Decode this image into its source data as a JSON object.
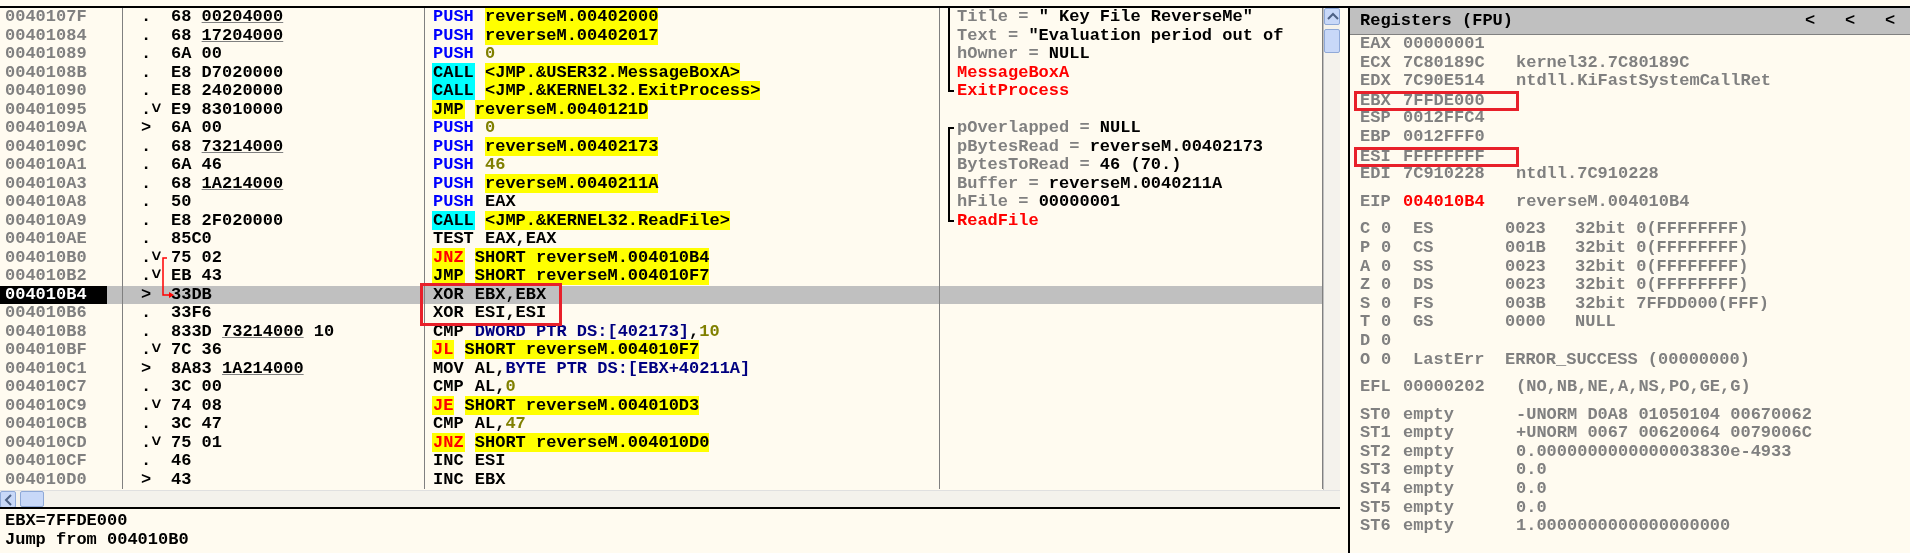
{
  "disassembly": {
    "rows": [
      {
        "address": "0040107F",
        "marker": ".",
        "opcode": "68",
        "hex_ref": "00204000",
        "mnemonic": "PUSH",
        "kind": "stack",
        "operand": [
          {
            "text": "reverseM.00402000",
            "kind": "ref"
          }
        ],
        "comment": {
          "kind": "arg",
          "name": "Title",
          "separator": "=",
          "value": "\" Key File ReverseMe\"",
          "nested": true
        },
        "selected": false,
        "annotated": false,
        "jump_source": false,
        "jump_target": false
      },
      {
        "address": "00401084",
        "marker": ".",
        "opcode": "68",
        "hex_ref": "17204000",
        "mnemonic": "PUSH",
        "kind": "stack",
        "operand": [
          {
            "text": "reverseM.00402017",
            "kind": "ref"
          }
        ],
        "comment": {
          "kind": "arg",
          "name": "Text",
          "separator": "=",
          "value": "\"Evaluation period out of",
          "nested": true
        },
        "selected": false,
        "annotated": false,
        "jump_source": false,
        "jump_target": false
      },
      {
        "address": "00401089",
        "marker": ".",
        "opcode": "6A 00",
        "mnemonic": "PUSH",
        "kind": "stack",
        "operand": [
          {
            "text": "0",
            "kind": "num"
          }
        ],
        "comment": {
          "kind": "arg",
          "name": "hOwner",
          "separator": "=",
          "value": "NULL",
          "nested": true
        },
        "selected": false,
        "annotated": false,
        "jump_source": false,
        "jump_target": false
      },
      {
        "address": "0040108B",
        "marker": ".",
        "opcode": "E8 D7020000",
        "mnemonic": "CALL",
        "kind": "invoke",
        "operand": [
          {
            "text": "<JMP.&USER32.MessageBoxA>",
            "kind": "ref"
          }
        ],
        "comment": {
          "kind": "call",
          "name": "MessageBoxA",
          "nested": true
        },
        "selected": false,
        "annotated": false,
        "jump_source": false,
        "jump_target": false
      },
      {
        "address": "00401090",
        "marker": ".",
        "opcode": "E8 24020000",
        "mnemonic": "CALL",
        "kind": "invoke",
        "operand": [
          {
            "text": "<JMP.&KERNEL32.ExitProcess>",
            "kind": "ref"
          }
        ],
        "comment": {
          "kind": "call",
          "name": "ExitProcess",
          "nested": false
        },
        "selected": false,
        "annotated": false,
        "jump_source": false,
        "jump_target": false
      },
      {
        "address": "00401095",
        "marker": ".˅",
        "opcode": "E9 83010000",
        "mnemonic": "JMP",
        "kind": "jump",
        "operand": [
          {
            "text": "reverseM.0040121D",
            "kind": "ref"
          }
        ],
        "selected": false,
        "annotated": false,
        "jump_source": false,
        "jump_target": false
      },
      {
        "address": "0040109A",
        "marker": ">",
        "opcode": "6A 00",
        "mnemonic": "PUSH",
        "kind": "stack",
        "operand": [
          {
            "text": "0",
            "kind": "num"
          }
        ],
        "comment": {
          "kind": "arg",
          "name": "pOverlapped",
          "separator": "=",
          "value": "NULL",
          "nested": false
        },
        "selected": false,
        "annotated": false,
        "jump_source": false,
        "jump_target": false
      },
      {
        "address": "0040109C",
        "marker": ".",
        "opcode": "68",
        "hex_ref": "73214000",
        "mnemonic": "PUSH",
        "kind": "stack",
        "operand": [
          {
            "text": "reverseM.00402173",
            "kind": "ref"
          }
        ],
        "comment": {
          "kind": "arg",
          "name": "pBytesRead",
          "separator": "=",
          "value": "reverseM.00402173",
          "nested": false
        },
        "selected": false,
        "annotated": false,
        "jump_source": false,
        "jump_target": false
      },
      {
        "address": "004010A1",
        "marker": ".",
        "opcode": "6A 46",
        "mnemonic": "PUSH",
        "kind": "stack",
        "operand": [
          {
            "text": "46",
            "kind": "num"
          }
        ],
        "comment": {
          "kind": "arg",
          "name": "BytesToRead",
          "separator": "=",
          "value": "46 (70.)",
          "nested": false
        },
        "selected": false,
        "annotated": false,
        "jump_source": false,
        "jump_target": false
      },
      {
        "address": "004010A3",
        "marker": ".",
        "opcode": "68",
        "hex_ref": "1A214000",
        "mnemonic": "PUSH",
        "kind": "stack",
        "operand": [
          {
            "text": "reverseM.0040211A",
            "kind": "ref"
          }
        ],
        "comment": {
          "kind": "arg",
          "name": "Buffer",
          "separator": "=",
          "value": "reverseM.0040211A",
          "nested": false
        },
        "selected": false,
        "annotated": false,
        "jump_source": false,
        "jump_target": false
      },
      {
        "address": "004010A8",
        "marker": ".",
        "opcode": "50",
        "mnemonic": "PUSH",
        "kind": "stack",
        "operand": [
          {
            "text": "EAX",
            "kind": "plain"
          }
        ],
        "comment": {
          "kind": "arg",
          "name": "hFile",
          "separator": "=",
          "value": "00000001",
          "nested": false
        },
        "selected": false,
        "annotated": false,
        "jump_source": false,
        "jump_target": false
      },
      {
        "address": "004010A9",
        "marker": ".",
        "opcode": "E8 2F020000",
        "mnemonic": "CALL",
        "kind": "invoke",
        "operand": [
          {
            "text": "<JMP.&KERNEL32.ReadFile>",
            "kind": "ref"
          }
        ],
        "comment": {
          "kind": "call",
          "name": "ReadFile",
          "nested": false
        },
        "selected": false,
        "annotated": false,
        "jump_source": false,
        "jump_target": false
      },
      {
        "address": "004010AE",
        "marker": ".",
        "opcode": "85C0",
        "mnemonic": "TEST",
        "kind": "plain",
        "operand": [
          {
            "text": "EAX,EAX",
            "kind": "plain"
          }
        ],
        "selected": false,
        "annotated": false,
        "jump_source": false,
        "jump_target": false
      },
      {
        "address": "004010B0",
        "marker": ".˅",
        "opcode": "75 02",
        "mnemonic": "JNZ",
        "kind": "branch",
        "operand": [
          {
            "text": "SHORT reverseM.004010B4",
            "kind": "ref"
          }
        ],
        "selected": false,
        "annotated": false,
        "jump_source": true,
        "jump_target": false
      },
      {
        "address": "004010B2",
        "marker": ".˅",
        "opcode": "EB 43",
        "mnemonic": "JMP",
        "kind": "jump",
        "operand": [
          {
            "text": "SHORT reverseM.004010F7",
            "kind": "ref"
          }
        ],
        "selected": false,
        "annotated": false,
        "jump_source": false,
        "jump_target": false
      },
      {
        "address": "004010B4",
        "marker": ">",
        "opcode": "33DB",
        "mnemonic": "XOR",
        "kind": "plain",
        "operand": [
          {
            "text": "EBX,EBX",
            "kind": "plain"
          }
        ],
        "selected": true,
        "annotated": true,
        "jump_source": false,
        "jump_target": true
      },
      {
        "address": "004010B6",
        "marker": ".",
        "opcode": "33F6",
        "mnemonic": "XOR",
        "kind": "plain",
        "operand": [
          {
            "text": "ESI,ESI",
            "kind": "plain"
          }
        ],
        "selected": false,
        "annotated": true,
        "jump_source": false,
        "jump_target": false
      },
      {
        "address": "004010B8",
        "marker": ".",
        "opcode": "833D",
        "hex_ref": "73214000",
        "hex_tail": "10",
        "mnemonic": "CMP",
        "kind": "plain",
        "operand": [
          {
            "text": "DWORD PTR DS:[402173]",
            "kind": "mem"
          },
          {
            "text": ",",
            "kind": "plain"
          },
          {
            "text": "10",
            "kind": "num"
          }
        ],
        "selected": false,
        "annotated": false,
        "jump_source": false,
        "jump_target": false
      },
      {
        "address": "004010BF",
        "marker": ".˅",
        "opcode": "7C 36",
        "mnemonic": "JL",
        "kind": "branch",
        "operand": [
          {
            "text": "SHORT reverseM.004010F7",
            "kind": "ref"
          }
        ],
        "selected": false,
        "annotated": false,
        "jump_source": false,
        "jump_target": false
      },
      {
        "address": "004010C1",
        "marker": ">",
        "opcode": "8A83",
        "hex_ref": "1A214000",
        "mnemonic": "MOV",
        "kind": "plain",
        "operand": [
          {
            "text": "AL,",
            "kind": "plain"
          },
          {
            "text": "BYTE PTR DS:[EBX+40211A]",
            "kind": "mem"
          }
        ],
        "selected": false,
        "annotated": false,
        "jump_source": false,
        "jump_target": false
      },
      {
        "address": "004010C7",
        "marker": ".",
        "opcode": "3C 00",
        "mnemonic": "CMP",
        "kind": "plain",
        "operand": [
          {
            "text": "AL,",
            "kind": "plain"
          },
          {
            "text": "0",
            "kind": "num"
          }
        ],
        "selected": false,
        "annotated": false,
        "jump_source": false,
        "jump_target": false
      },
      {
        "address": "004010C9",
        "marker": ".˅",
        "opcode": "74 08",
        "mnemonic": "JE",
        "kind": "branch",
        "operand": [
          {
            "text": "SHORT reverseM.004010D3",
            "kind": "ref"
          }
        ],
        "selected": false,
        "annotated": false,
        "jump_source": false,
        "jump_target": false
      },
      {
        "address": "004010CB",
        "marker": ".",
        "opcode": "3C 47",
        "mnemonic": "CMP",
        "kind": "plain",
        "operand": [
          {
            "text": "AL,",
            "kind": "plain"
          },
          {
            "text": "47",
            "kind": "num"
          }
        ],
        "selected": false,
        "annotated": false,
        "jump_source": false,
        "jump_target": false
      },
      {
        "address": "004010CD",
        "marker": ".˅",
        "opcode": "75 01",
        "mnemonic": "JNZ",
        "kind": "branch",
        "operand": [
          {
            "text": "SHORT reverseM.004010D0",
            "kind": "ref"
          }
        ],
        "selected": false,
        "annotated": false,
        "jump_source": false,
        "jump_target": false
      },
      {
        "address": "004010CF",
        "marker": ".",
        "opcode": "46",
        "mnemonic": "INC",
        "kind": "plain",
        "operand": [
          {
            "text": "ESI",
            "kind": "plain"
          }
        ],
        "selected": false,
        "annotated": false,
        "jump_source": false,
        "jump_target": false
      },
      {
        "address": "004010D0",
        "marker": ">",
        "opcode": "43",
        "mnemonic": "INC",
        "kind": "plain",
        "operand": [
          {
            "text": "EBX",
            "kind": "plain"
          }
        ],
        "selected": false,
        "annotated": false,
        "jump_source": false,
        "jump_target": false
      }
    ]
  },
  "info_pane": {
    "lines": [
      "EBX=7FFDE000",
      "Jump from 004010B0"
    ]
  },
  "registers": {
    "title": "Registers (FPU)",
    "header_buttons": [
      "<",
      "<",
      "<"
    ],
    "groups": [
      [
        {
          "kind": "reg",
          "name": "EAX",
          "value": "00000001",
          "changed": false,
          "annotated": false
        },
        {
          "kind": "reg",
          "name": "ECX",
          "value": "7C80189C",
          "comment": "kernel32.7C80189C",
          "changed": false,
          "annotated": false
        },
        {
          "kind": "reg",
          "name": "EDX",
          "value": "7C90E514",
          "comment": "ntdll.KiFastSystemCallRet",
          "changed": false,
          "annotated": false
        },
        {
          "kind": "reg",
          "name": "EBX",
          "value": "7FFDE000",
          "changed": false,
          "annotated": true
        },
        {
          "kind": "reg",
          "name": "ESP",
          "value": "0012FFC4",
          "changed": false,
          "annotated": false
        },
        {
          "kind": "reg",
          "name": "EBP",
          "value": "0012FFF0",
          "changed": false,
          "annotated": false
        },
        {
          "kind": "reg",
          "name": "ESI",
          "value": "FFFFFFFF",
          "changed": false,
          "annotated": true
        },
        {
          "kind": "reg",
          "name": "EDI",
          "value": "7C910228",
          "comment": "ntdll.7C910228",
          "changed": false,
          "annotated": false
        }
      ],
      [
        {
          "kind": "reg",
          "name": "EIP",
          "value": "004010B4",
          "comment": "reverseM.004010B4",
          "changed": true,
          "annotated": false
        }
      ],
      [
        {
          "kind": "flag",
          "flag": "C",
          "bit": "0",
          "name": "ES",
          "value": "0023",
          "comment": "32bit 0(FFFFFFFF)"
        },
        {
          "kind": "flag",
          "flag": "P",
          "bit": "0",
          "name": "CS",
          "value": "001B",
          "comment": "32bit 0(FFFFFFFF)"
        },
        {
          "kind": "flag",
          "flag": "A",
          "bit": "0",
          "name": "SS",
          "value": "0023",
          "comment": "32bit 0(FFFFFFFF)"
        },
        {
          "kind": "flag",
          "flag": "Z",
          "bit": "0",
          "name": "DS",
          "value": "0023",
          "comment": "32bit 0(FFFFFFFF)"
        },
        {
          "kind": "flag",
          "flag": "S",
          "bit": "0",
          "name": "FS",
          "value": "003B",
          "comment": "32bit 7FFDD000(FFF)"
        },
        {
          "kind": "flag",
          "flag": "T",
          "bit": "0",
          "name": "GS",
          "value": "0000",
          "comment": "NULL"
        },
        {
          "kind": "flag",
          "flag": "D",
          "bit": "0"
        },
        {
          "kind": "flag",
          "flag": "O",
          "bit": "0",
          "name": "LastErr",
          "value": "ERROR_SUCCESS (00000000)"
        }
      ],
      [
        {
          "kind": "reg",
          "name": "EFL",
          "value": "00000202",
          "comment": "(NO,NB,NE,A,NS,PO,GE,G)",
          "changed": false,
          "annotated": false
        }
      ],
      [
        {
          "kind": "reg",
          "name": "ST0",
          "value": "empty",
          "comment": "-UNORM D0A8 01050104 00670062",
          "changed": false,
          "annotated": false
        },
        {
          "kind": "reg",
          "name": "ST1",
          "value": "empty",
          "comment": "+UNORM 0067 00620064 0079006C",
          "changed": false,
          "annotated": false
        },
        {
          "kind": "reg",
          "name": "ST2",
          "value": "empty",
          "comment": "0.0000000000000003830e-4933",
          "changed": false,
          "annotated": false
        },
        {
          "kind": "reg",
          "name": "ST3",
          "value": "empty",
          "comment": "0.0",
          "changed": false,
          "annotated": false
        },
        {
          "kind": "reg",
          "name": "ST4",
          "value": "empty",
          "comment": "0.0",
          "changed": false,
          "annotated": false
        },
        {
          "kind": "reg",
          "name": "ST5",
          "value": "empty",
          "comment": "0.0",
          "changed": false,
          "annotated": false
        },
        {
          "kind": "reg",
          "name": "ST6",
          "value": "empty",
          "comment": "1.0000000000000000000",
          "changed": false,
          "annotated": false
        }
      ]
    ]
  }
}
